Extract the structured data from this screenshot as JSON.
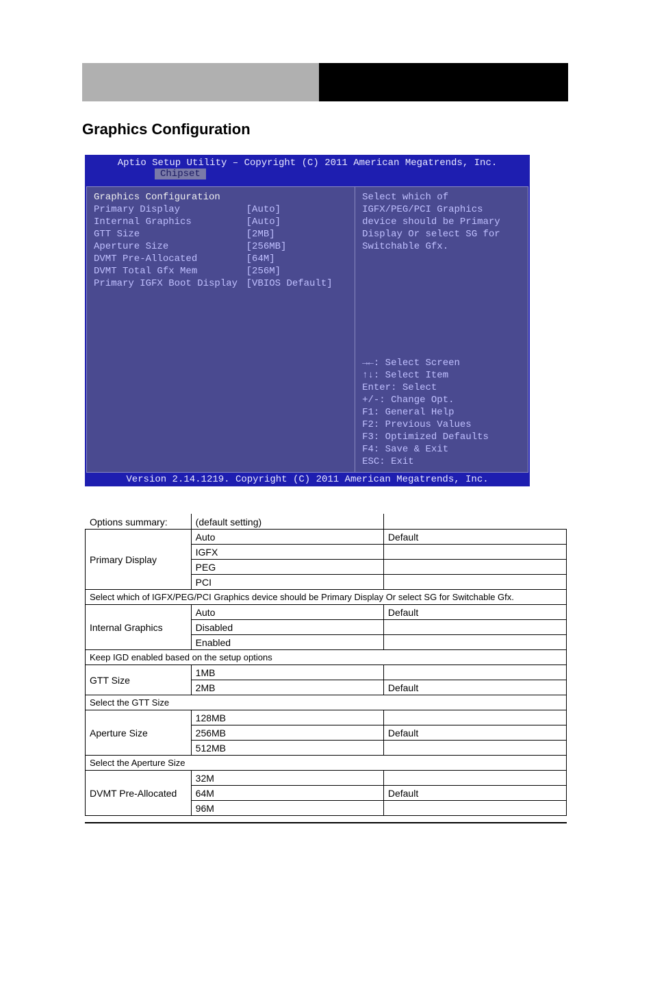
{
  "header_right": "",
  "section_title": "Graphics Configuration",
  "bios": {
    "title": "Aptio Setup Utility – Copyright (C) 2011 American Megatrends, Inc.",
    "tab": "Chipset",
    "heading": "Graphics Configuration",
    "items": [
      {
        "label": "Primary Display",
        "value": "[Auto]"
      },
      {
        "label": "Internal Graphics",
        "value": "[Auto]"
      },
      {
        "label": "GTT Size",
        "value": "[2MB]"
      },
      {
        "label": "Aperture Size",
        "value": "[256MB]"
      },
      {
        "label": "DVMT Pre-Allocated",
        "value": "[64M]"
      },
      {
        "label": "DVMT Total Gfx Mem",
        "value": "[256M]"
      },
      {
        "label": "Primary IGFX Boot Display",
        "value": "[VBIOS Default]"
      }
    ],
    "help_description": "Select which of IGFX/PEG/PCI Graphics device should be Primary Display Or select SG for Switchable Gfx.",
    "help_keys": [
      "→←: Select Screen",
      "↑↓: Select Item",
      "Enter: Select",
      "+/-: Change Opt.",
      "F1: General Help",
      "F2: Previous Values",
      "F3: Optimized Defaults",
      "F4: Save & Exit",
      "ESC: Exit"
    ],
    "footer": "Version 2.14.1219. Copyright (C) 2011 American Megatrends, Inc."
  },
  "table_header": {
    "c1": "Options summary:",
    "c2": "(default setting)"
  },
  "rows": [
    {
      "name": "Primary Display",
      "options": [
        "Auto",
        "IGFX",
        "PEG",
        "PCI"
      ],
      "defaults": [
        "Default",
        "",
        "",
        ""
      ],
      "desc": "Select which of IGFX/PEG/PCI Graphics device should be Primary Display Or select SG for Switchable Gfx."
    },
    {
      "name": "Internal Graphics",
      "options": [
        "Auto",
        "Disabled",
        "Enabled"
      ],
      "defaults": [
        "Default",
        "",
        ""
      ],
      "desc": "Keep IGD enabled based on the setup options"
    },
    {
      "name": "GTT Size",
      "options": [
        "1MB",
        "2MB"
      ],
      "defaults": [
        "",
        "Default"
      ],
      "desc": "Select the GTT Size"
    },
    {
      "name": "Aperture Size",
      "options": [
        "128MB",
        "256MB",
        "512MB"
      ],
      "defaults": [
        "",
        "Default",
        ""
      ],
      "desc": "Select the Aperture Size"
    },
    {
      "name": "DVMT Pre-Allocated",
      "options": [
        "32M",
        "64M",
        "96M"
      ],
      "defaults": [
        "",
        "Default",
        ""
      ],
      "desc": ""
    }
  ]
}
